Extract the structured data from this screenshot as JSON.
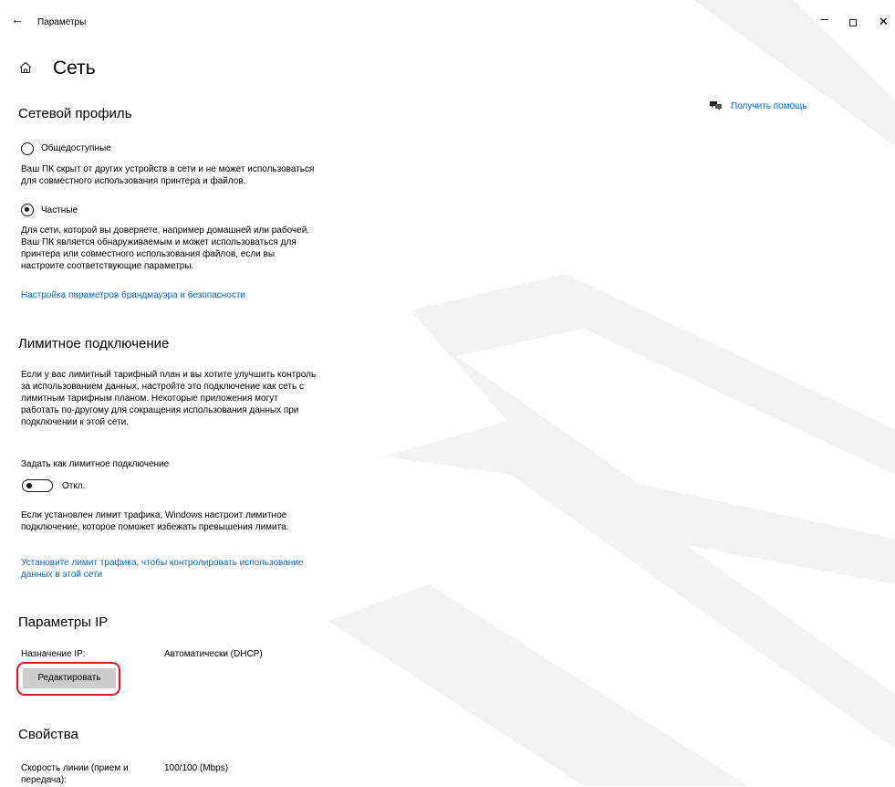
{
  "window": {
    "back_glyph": "←",
    "title": "Параметры",
    "minimize_glyph": "–",
    "close_glyph": "✕"
  },
  "page": {
    "title": "Сеть"
  },
  "help": {
    "label": "Получить помощь"
  },
  "network_profile": {
    "heading": "Сетевой профиль",
    "public": {
      "label": "Общедоступные",
      "selected": false,
      "description": [
        "Ваш ПК скрыт от других устройств в сети и не может использоваться",
        "для совместного использования принтера и файлов."
      ]
    },
    "private": {
      "label": "Частные",
      "selected": true,
      "description": [
        "Для сети, которой вы доверяете, например домашней или рабочей.",
        "Ваш ПК является обнаруживаемым и может использоваться для",
        "принтера или совместного использования файлов, если вы",
        "настроите соответствующие параметры."
      ]
    },
    "firewall_link": "Настройка параметров брандмауэра и безопасности"
  },
  "metered": {
    "heading": "Лимитное подключение",
    "description": [
      "Если у вас лимитный тарифный план и вы хотите улучшить контроль",
      "за использованием данных, настройте это подключение как сеть с",
      "лимитным тарифным планом. Некоторые приложения могут",
      "работать по-другому для сокращения использования данных при",
      "подключении к этой сети."
    ],
    "toggle_caption": "Задать как лимитное подключение",
    "toggle_state": "Откл.",
    "toggle_on": false,
    "limit_note": [
      "Если установлен лимит трафика, Windows настроит лимитное",
      "подключение, которое поможет избежать превышения лимита."
    ],
    "limit_link": [
      "Установите лимит трафика, чтобы контролировать использование",
      "данных в этой сети"
    ]
  },
  "ip": {
    "heading": "Параметры IP",
    "assignment_label": "Назначение IP:",
    "assignment_value": "Автоматически (DHCP)",
    "edit_button": "Редактировать"
  },
  "properties": {
    "heading": "Свойства",
    "speed_label": [
      "Скорость линии (прием и",
      "передача):"
    ],
    "speed_value": "100/100 (Mbps)"
  },
  "colors": {
    "link": "#0a6bc1",
    "highlight": "#e0191c",
    "button": "#cccccc",
    "watermark": "#f2f2f2"
  }
}
